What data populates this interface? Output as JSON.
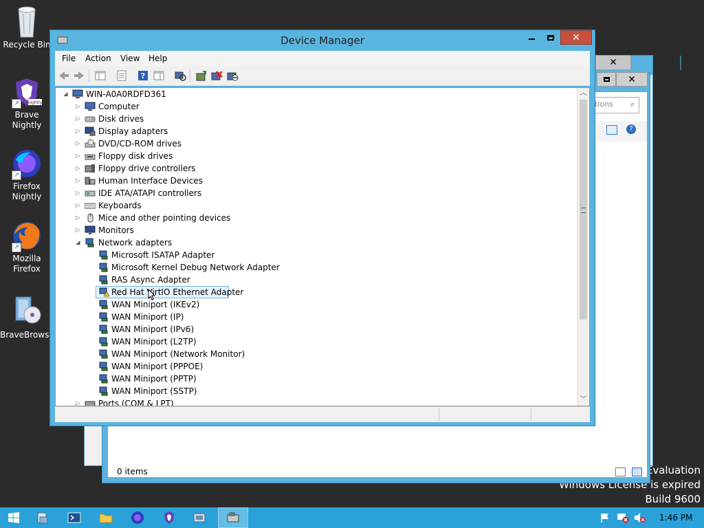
{
  "desktop": {
    "icons": [
      {
        "label": "Recycle Bin"
      },
      {
        "label": "Brave Nightly"
      },
      {
        "label": "Firefox Nightly"
      },
      {
        "label": "Mozilla Firefox"
      },
      {
        "label": "BraveBrows..."
      }
    ],
    "watermark": {
      "line1": "Evaluation",
      "line2": "Windows License is expired",
      "line3": "Build 9600"
    }
  },
  "background_window": {
    "search_placeholder": "tions",
    "status_text": "0 items"
  },
  "device_manager": {
    "title": "Device Manager",
    "menu": [
      "File",
      "Action",
      "View",
      "Help"
    ],
    "tree": {
      "root": "WIN-A0A0RDFD361",
      "categories": [
        "Computer",
        "Disk drives",
        "Display adapters",
        "DVD/CD-ROM drives",
        "Floppy disk drives",
        "Floppy drive controllers",
        "Human Interface Devices",
        "IDE ATA/ATAPI controllers",
        "Keyboards",
        "Mice and other pointing devices",
        "Monitors",
        "Network adapters"
      ],
      "network_adapters": [
        "Microsoft ISATAP Adapter",
        "Microsoft Kernel Debug Network Adapter",
        "RAS Async Adapter",
        "Red Hat VirtIO Ethernet Adapter",
        "WAN Miniport (IKEv2)",
        "WAN Miniport (IP)",
        "WAN Miniport (IPv6)",
        "WAN Miniport (L2TP)",
        "WAN Miniport (Network Monitor)",
        "WAN Miniport (PPPOE)",
        "WAN Miniport (PPTP)",
        "WAN Miniport (SSTP)"
      ],
      "partial_category": "Ports (COM & LPT)",
      "selected_item": "Red Hat VirtIO Ethernet Adapter"
    }
  },
  "taskbar": {
    "clock": "1:46 PM",
    "accent": "#2aa1d8"
  }
}
